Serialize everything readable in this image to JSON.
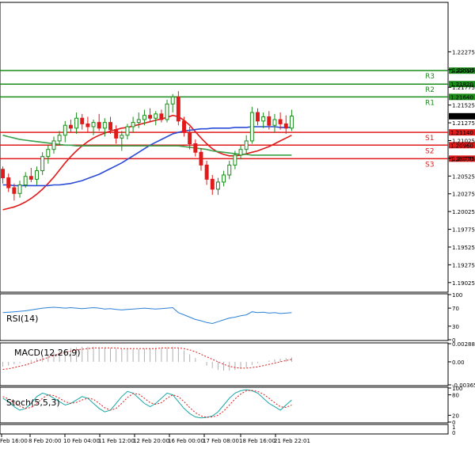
{
  "chart_data": {
    "type": "candlestick",
    "price_axis": {
      "ylim": [
        1.189,
        1.2296
      ],
      "ticks": [
        "1.22275",
        "1.22025",
        "1.21775",
        "1.21525",
        "1.21275",
        "1.21025",
        "1.20775",
        "1.20525",
        "1.20275",
        "1.20025",
        "1.19775",
        "1.19525",
        "1.19275",
        "1.19025"
      ],
      "current_price": "1.21367"
    },
    "levels": [
      {
        "name": "R3",
        "value": 1.2201,
        "label": "1.22010",
        "color": "#1a8c1a"
      },
      {
        "name": "R2",
        "value": 1.2182,
        "label": "1.21820",
        "color": "#1a8c1a"
      },
      {
        "name": "R1",
        "value": 1.2164,
        "label": "1.21640",
        "color": "#1a8c1a"
      },
      {
        "name": "S1",
        "value": 1.2114,
        "label": "1.21140",
        "color": "#e01b1b"
      },
      {
        "name": "S2",
        "value": 1.2096,
        "label": "1.20960",
        "color": "#e01b1b"
      },
      {
        "name": "S3",
        "value": 1.2077,
        "label": "1.20770",
        "color": "#e01b1b"
      }
    ],
    "x_labels": [
      "Feb 16:00",
      "8 Feb 20:00",
      "10 Feb 04:00",
      "11 Feb 12:00",
      "12 Feb 20:00",
      "16 Feb 00:00",
      "17 Feb 08:00",
      "18 Feb 16:00",
      "21 Feb 22:01"
    ],
    "candles": [
      [
        1.2062,
        1.2066,
        1.2042,
        1.205
      ],
      [
        1.205,
        1.2056,
        1.203,
        1.2036
      ],
      [
        1.2036,
        1.2042,
        1.2018,
        1.2028
      ],
      [
        1.2028,
        1.2046,
        1.2022,
        1.204
      ],
      [
        1.204,
        1.2058,
        1.2036,
        1.2052
      ],
      [
        1.2052,
        1.2064,
        1.2044,
        1.2048
      ],
      [
        1.2048,
        1.2066,
        1.204,
        1.206
      ],
      [
        1.206,
        1.2086,
        1.2054,
        1.208
      ],
      [
        1.208,
        1.2096,
        1.207,
        1.209
      ],
      [
        1.209,
        1.2108,
        1.2084,
        1.2102
      ],
      [
        1.2102,
        1.2116,
        1.2096,
        1.211
      ],
      [
        1.211,
        1.213,
        1.21,
        1.2124
      ],
      [
        1.2124,
        1.2132,
        1.2114,
        1.212
      ],
      [
        1.212,
        1.2142,
        1.2112,
        1.2134
      ],
      [
        1.2134,
        1.214,
        1.2118,
        1.2126
      ],
      [
        1.2126,
        1.2136,
        1.2114,
        1.2122
      ],
      [
        1.2122,
        1.2132,
        1.211,
        1.2128
      ],
      [
        1.2128,
        1.214,
        1.2116,
        1.212
      ],
      [
        1.212,
        1.2134,
        1.2108,
        1.2128
      ],
      [
        1.2128,
        1.2136,
        1.2112,
        1.2118
      ],
      [
        1.2118,
        1.2124,
        1.2098,
        1.2106
      ],
      [
        1.2106,
        1.2116,
        1.2088,
        1.211
      ],
      [
        1.211,
        1.2126,
        1.2104,
        1.2122
      ],
      [
        1.2122,
        1.2136,
        1.2114,
        1.2128
      ],
      [
        1.2128,
        1.2142,
        1.212,
        1.2132
      ],
      [
        1.2132,
        1.2146,
        1.2124,
        1.2138
      ],
      [
        1.2138,
        1.2148,
        1.2128,
        1.2134
      ],
      [
        1.2134,
        1.2144,
        1.2124,
        1.214
      ],
      [
        1.214,
        1.2146,
        1.2128,
        1.2132
      ],
      [
        1.2132,
        1.216,
        1.2128,
        1.2154
      ],
      [
        1.2154,
        1.2168,
        1.2142,
        1.2164
      ],
      [
        1.2164,
        1.2172,
        1.2124,
        1.213
      ],
      [
        1.213,
        1.2136,
        1.2108,
        1.2114
      ],
      [
        1.2114,
        1.2122,
        1.209,
        1.2098
      ],
      [
        1.2098,
        1.2104,
        1.208,
        1.2086
      ],
      [
        1.2086,
        1.2092,
        1.206,
        1.2068
      ],
      [
        1.2068,
        1.2074,
        1.204,
        1.2048
      ],
      [
        1.2048,
        1.2054,
        1.2026,
        1.2034
      ],
      [
        1.2034,
        1.205,
        1.2026,
        1.2044
      ],
      [
        1.2044,
        1.206,
        1.2038,
        1.2054
      ],
      [
        1.2054,
        1.2074,
        1.2048,
        1.2068
      ],
      [
        1.2068,
        1.2088,
        1.2062,
        1.2082
      ],
      [
        1.2082,
        1.2096,
        1.2076,
        1.209
      ],
      [
        1.209,
        1.211,
        1.2084,
        1.2102
      ],
      [
        1.2102,
        1.215,
        1.2098,
        1.2142
      ],
      [
        1.2142,
        1.2148,
        1.2124,
        1.213
      ],
      [
        1.213,
        1.2142,
        1.212,
        1.2136
      ],
      [
        1.2136,
        1.2144,
        1.2118,
        1.2124
      ],
      [
        1.2124,
        1.214,
        1.2114,
        1.2132
      ],
      [
        1.2132,
        1.2142,
        1.2118,
        1.2126
      ],
      [
        1.2126,
        1.2138,
        1.2112,
        1.212
      ],
      [
        1.212,
        1.2146,
        1.2116,
        1.2137
      ]
    ],
    "series": [
      {
        "name": "",
        "color": "#e01b1b",
        "values": [
          1.2005,
          1.2007,
          1.2009,
          1.2012,
          1.2016,
          1.2021,
          1.2027,
          1.2034,
          1.2042,
          1.2051,
          1.2061,
          1.2071,
          1.208,
          1.2088,
          1.2095,
          1.2101,
          1.2106,
          1.211,
          1.2113,
          1.2116,
          1.2118,
          1.212,
          1.2121,
          1.2123,
          1.2125,
          1.2127,
          1.2129,
          1.2131,
          1.2133,
          1.2135,
          1.2138,
          1.2136,
          1.2131,
          1.2124,
          1.2115,
          1.2106,
          1.2098,
          1.2091,
          1.2086,
          1.2083,
          1.2081,
          1.2081,
          1.2082,
          1.2084,
          1.2086,
          1.2088,
          1.2091,
          1.2094,
          1.2098,
          1.2102,
          1.2106,
          1.211
        ]
      },
      {
        "name": "",
        "color": "#2a4bd7",
        "values": [
          1.204,
          1.204,
          1.2039,
          1.2039,
          1.2039,
          1.2039,
          1.2039,
          1.2039,
          1.2039,
          1.204,
          1.204,
          1.2041,
          1.2042,
          1.2044,
          1.2046,
          1.2049,
          1.2052,
          1.2055,
          1.2059,
          1.2063,
          1.2067,
          1.2071,
          1.2076,
          1.2081,
          1.2086,
          1.2091,
          1.2096,
          1.21,
          1.2104,
          1.2108,
          1.2112,
          1.2114,
          1.2116,
          1.2117,
          1.2118,
          1.2119,
          1.2119,
          1.212,
          1.212,
          1.212,
          1.212,
          1.2121,
          1.2121,
          1.2121,
          1.2122,
          1.2122,
          1.2122,
          1.2122,
          1.2122,
          1.2121,
          1.2121,
          1.2121
        ]
      },
      {
        "name": "",
        "color": "#3aa04a",
        "values": [
          1.211,
          1.2108,
          1.2106,
          1.2104,
          1.2103,
          1.2102,
          1.2101,
          1.21,
          1.2099,
          1.2098,
          1.2097,
          1.2096,
          1.2096,
          1.2095,
          1.2095,
          1.2095,
          1.2095,
          1.2095,
          1.2095,
          1.2095,
          1.2095,
          1.2095,
          1.2095,
          1.2095,
          1.2095,
          1.2095,
          1.2095,
          1.2095,
          1.2095,
          1.2095,
          1.2095,
          1.2095,
          1.2094,
          1.2093,
          1.2092,
          1.2091,
          1.209,
          1.2088,
          1.2087,
          1.2086,
          1.2085,
          1.2084,
          1.2083,
          1.2083,
          1.2082,
          1.2082,
          1.2082,
          1.2082,
          1.2082,
          1.2082,
          1.2082,
          1.2082
        ]
      }
    ],
    "rsi": {
      "label": "RSI(14)",
      "ticks": [
        "100",
        "70",
        "30",
        "0"
      ],
      "values": [
        60,
        61,
        62,
        63,
        64,
        66,
        68,
        70,
        71,
        72,
        71,
        70,
        71,
        70,
        69,
        70,
        71,
        70,
        68,
        69,
        67,
        66,
        67,
        68,
        69,
        70,
        69,
        68,
        69,
        70,
        71,
        60,
        55,
        50,
        45,
        42,
        38,
        36,
        40,
        44,
        48,
        50,
        53,
        55,
        62,
        60,
        61,
        59,
        60,
        58,
        59,
        60
      ]
    },
    "macd": {
      "label": "MACD(12,26,9)",
      "ticks": [
        "0.002883",
        "0.00",
        "-0.003654"
      ],
      "ylim": [
        -0.003654,
        0.002883
      ],
      "histogram": [
        -0.0008,
        -0.0006,
        -0.0004,
        -0.0002,
        0.0,
        0.0003,
        0.0006,
        0.0009,
        0.0012,
        0.0015,
        0.0018,
        0.002,
        0.0022,
        0.0023,
        0.0024,
        0.0024,
        0.0024,
        0.0023,
        0.0023,
        0.0022,
        0.0021,
        0.002,
        0.002,
        0.002,
        0.002,
        0.0021,
        0.0021,
        0.0022,
        0.0022,
        0.0023,
        0.0024,
        0.0022,
        0.0018,
        0.0012,
        0.0006,
        0.0,
        -0.0006,
        -0.001,
        -0.0013,
        -0.0014,
        -0.0014,
        -0.0013,
        -0.0011,
        -0.0009,
        -0.0005,
        -0.0002,
        0.0,
        0.0002,
        0.0004,
        0.0005,
        0.0006,
        0.0007
      ],
      "signal": [
        -0.0012,
        -0.0011,
        -0.0009,
        -0.0007,
        -0.0005,
        -0.0002,
        0.0001,
        0.0004,
        0.0007,
        0.001,
        0.0013,
        0.0015,
        0.0017,
        0.0019,
        0.002,
        0.0021,
        0.0022,
        0.0022,
        0.0022,
        0.0022,
        0.0022,
        0.0021,
        0.0021,
        0.0021,
        0.0021,
        0.0021,
        0.0021,
        0.0021,
        0.0022,
        0.0022,
        0.0022,
        0.0022,
        0.0021,
        0.0019,
        0.0016,
        0.0012,
        0.0008,
        0.0004,
        0.0,
        -0.0004,
        -0.0007,
        -0.0009,
        -0.001,
        -0.001,
        -0.0009,
        -0.0008,
        -0.0006,
        -0.0004,
        -0.0002,
        0.0,
        0.0002,
        0.0004
      ]
    },
    "stoch": {
      "label": "Stoch(5,5,3)",
      "ticks": [
        "100",
        "80",
        "20",
        "0"
      ],
      "main": [
        70,
        60,
        45,
        35,
        40,
        55,
        75,
        85,
        80,
        70,
        60,
        50,
        55,
        65,
        75,
        70,
        55,
        40,
        30,
        35,
        55,
        75,
        90,
        85,
        70,
        55,
        45,
        55,
        70,
        85,
        80,
        60,
        40,
        25,
        15,
        12,
        14,
        18,
        30,
        50,
        70,
        85,
        92,
        95,
        92,
        85,
        70,
        55,
        45,
        35,
        50,
        65
      ],
      "signal": [
        75,
        68,
        57,
        47,
        40,
        43,
        55,
        70,
        80,
        78,
        70,
        60,
        55,
        58,
        65,
        70,
        67,
        55,
        42,
        35,
        40,
        55,
        72,
        84,
        82,
        70,
        57,
        52,
        57,
        70,
        80,
        75,
        60,
        42,
        28,
        18,
        14,
        15,
        20,
        32,
        50,
        68,
        82,
        92,
        93,
        90,
        82,
        70,
        57,
        45,
        43,
        50
      ]
    },
    "separator_bar_ticks": [
      "1",
      "0"
    ]
  }
}
